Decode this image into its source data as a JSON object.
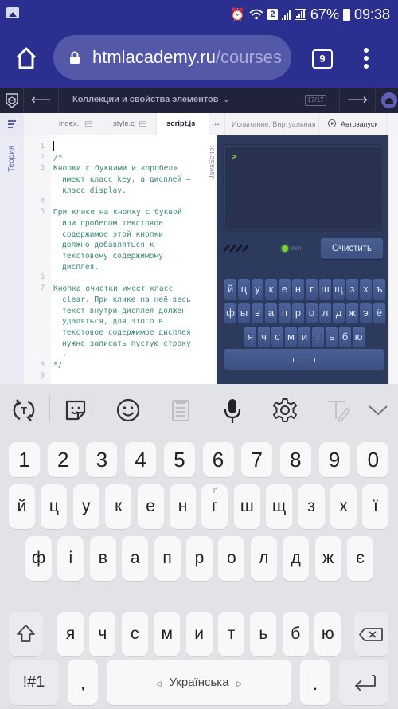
{
  "status_bar": {
    "battery": "67%",
    "time": "09:38",
    "sim_slot": "2",
    "icons": [
      "gallery-icon",
      "alarm-icon",
      "wifi-icon",
      "sim2-icon",
      "signal-icon",
      "signal-icon",
      "battery-icon"
    ]
  },
  "browser": {
    "url_host": "htmlacademy.ru",
    "url_path": "/courses",
    "tab_count": "9"
  },
  "academy_header": {
    "back_arrow": "⟵",
    "lesson_title": "Коллекции и свойства элементов",
    "title_chevron": "⌄",
    "progress": "17/17",
    "next_arrow": "⟶"
  },
  "editor_tabs": {
    "files": [
      {
        "label": "index.l",
        "active": false
      },
      {
        "label": "style.c",
        "active": false
      },
      {
        "label": "script.js",
        "active": true
      }
    ],
    "resize": "↔",
    "test_tab": "Испытание: Виртуальная",
    "autorun": "Автозапуск"
  },
  "sidebar": {
    "theory_label": "Теория"
  },
  "editor": {
    "language": "JavaScript",
    "lines": [
      {
        "n": "1",
        "segments": [
          ""
        ]
      },
      {
        "n": "2",
        "segments": [
          "/*"
        ]
      },
      {
        "n": "3",
        "segments": [
          "Кнопки с буквами и «пробел»",
          "имеют класс key, а дисплей —",
          "класс display."
        ]
      },
      {
        "n": "4",
        "segments": [
          ""
        ]
      },
      {
        "n": "5",
        "segments": [
          "При клике на кнопку с буквой",
          "или пробелом текстовое",
          "содержимое этой кнопки",
          "должно добавляться к",
          "текстовому содержимому",
          "дисплея."
        ]
      },
      {
        "n": "6",
        "segments": [
          ""
        ]
      },
      {
        "n": "7",
        "segments": [
          "Кнопка очистки имеет класс",
          "clear. При клике на неё весь",
          "текст внутри дисплея должен",
          "удаляться, для этого в",
          "текстовое содержимое дисплея",
          "нужно записать пустую строку",
          "."
        ]
      },
      {
        "n": "8",
        "segments": [
          "*/"
        ]
      },
      {
        "n": "9",
        "segments": [
          ""
        ]
      }
    ]
  },
  "preview": {
    "prompt": ">",
    "led_label": "вкл",
    "clear_button": "Очистить",
    "rows": [
      [
        "й",
        "ц",
        "у",
        "к",
        "е",
        "н",
        "г",
        "ш",
        "щ",
        "з",
        "х",
        "ъ"
      ],
      [
        "ф",
        "ы",
        "в",
        "а",
        "п",
        "р",
        "о",
        "л",
        "д",
        "ж",
        "э",
        "ё"
      ],
      [
        "я",
        "ч",
        "с",
        "м",
        "и",
        "т",
        "ь",
        "б",
        "ю"
      ]
    ],
    "space_label": "space"
  },
  "keyboard_toolbar": {
    "items": [
      "text-swap-icon",
      "sticker-icon",
      "emoji-icon",
      "clipboard-icon",
      "microphone-icon",
      "settings-icon",
      "handwriting-icon",
      "collapse-chevron-icon"
    ]
  },
  "keyboard": {
    "numbers": [
      "1",
      "2",
      "3",
      "4",
      "5",
      "6",
      "7",
      "8",
      "9",
      "0"
    ],
    "row1": [
      "й",
      "ц",
      "у",
      "к",
      "е",
      "н",
      "г",
      "ш",
      "щ",
      "з",
      "х",
      "ї"
    ],
    "row1_hints": {
      "6": "ґ"
    },
    "row2": [
      "ф",
      "і",
      "в",
      "а",
      "п",
      "р",
      "о",
      "л",
      "д",
      "ж",
      "є"
    ],
    "row3": [
      "я",
      "ч",
      "с",
      "м",
      "и",
      "т",
      "ь",
      "б",
      "ю"
    ],
    "symbols_key": "!#1",
    "comma_key": ",",
    "space_label": "Українська",
    "space_left": "◁",
    "space_right": "▷",
    "period_key": "."
  }
}
